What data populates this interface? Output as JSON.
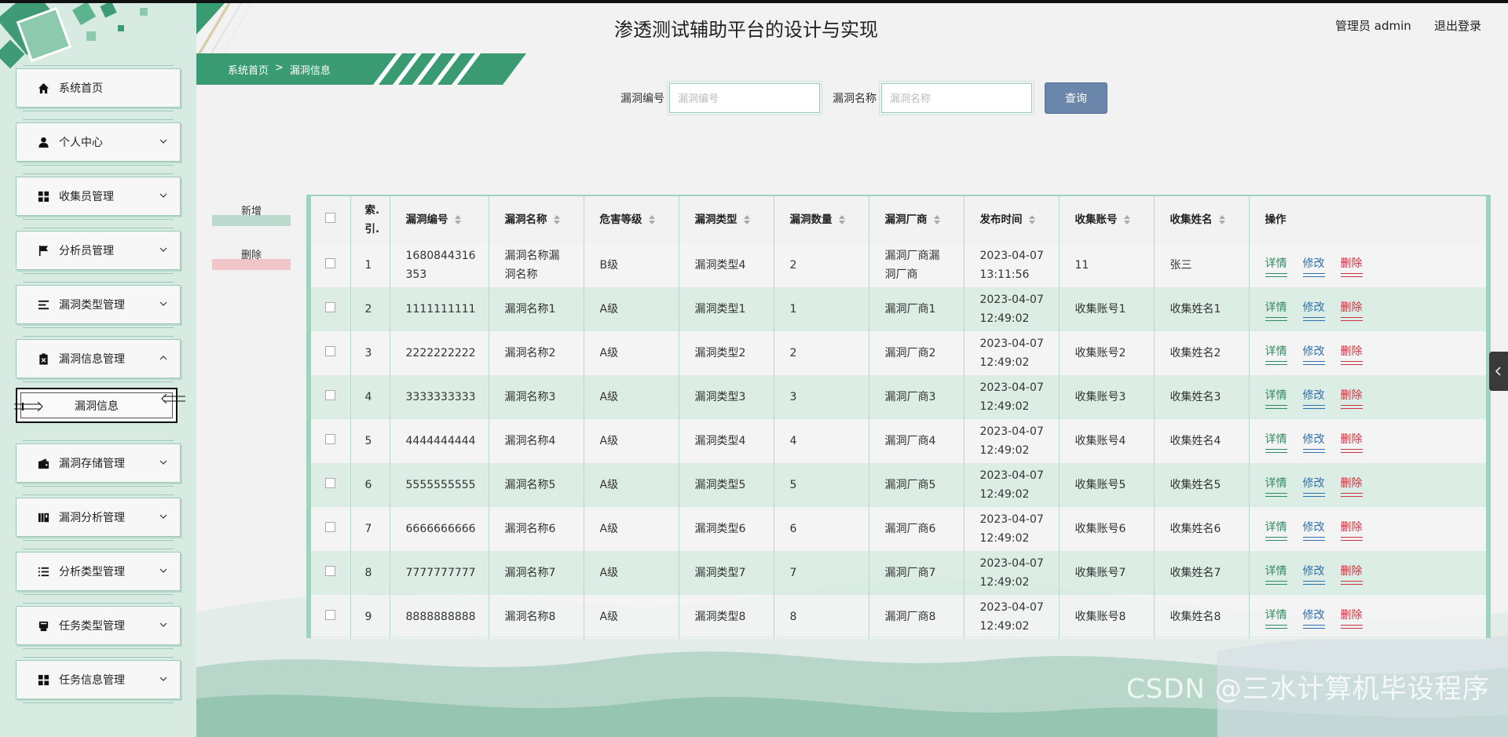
{
  "app": {
    "title": "渗透测试辅助平台的设计与实现",
    "user_label": "管理员 admin",
    "logout_label": "退出登录"
  },
  "breadcrumb": {
    "home": "系统首页",
    "separator": ">",
    "current": "漏洞信息"
  },
  "search": {
    "field1_label": "漏洞编号",
    "field1_placeholder": "漏洞编号",
    "field2_label": "漏洞名称",
    "field2_placeholder": "漏洞名称",
    "button_label": "查询"
  },
  "actions": {
    "add_label": "新增",
    "delete_label": "删除"
  },
  "sidebar": {
    "items": [
      {
        "label": "系统首页",
        "icon": "home-icon",
        "expandable": false
      },
      {
        "label": "个人中心",
        "icon": "user-icon",
        "expandable": true
      },
      {
        "label": "收集员管理",
        "icon": "grid-icon",
        "expandable": true
      },
      {
        "label": "分析员管理",
        "icon": "flag-icon",
        "expandable": true
      },
      {
        "label": "漏洞类型管理",
        "icon": "list-icon",
        "expandable": true
      },
      {
        "label": "漏洞信息管理",
        "icon": "clipboard-icon",
        "expandable": true,
        "expanded": true
      },
      {
        "label": "漏洞存储管理",
        "icon": "wallet-icon",
        "expandable": true
      },
      {
        "label": "漏洞分析管理",
        "icon": "book-icon",
        "expandable": true
      },
      {
        "label": "分析类型管理",
        "icon": "list-icon",
        "expandable": true
      },
      {
        "label": "任务类型管理",
        "icon": "printer-icon",
        "expandable": true
      },
      {
        "label": "任务信息管理",
        "icon": "grid-icon",
        "expandable": true
      }
    ],
    "active_sub_item": "漏洞信息"
  },
  "table": {
    "headers": [
      "索引",
      "漏洞编号",
      "漏洞名称",
      "危害等级",
      "漏洞类型",
      "漏洞数量",
      "漏洞厂商",
      "发布时间",
      "收集账号",
      "收集姓名",
      "操作"
    ],
    "index_header_line1": "索.",
    "index_header_line2": "引.",
    "rows": [
      {
        "idx": "1",
        "code_line1": "1680844316",
        "code_line2": "353",
        "name_line1": "漏洞名称漏",
        "name_line2": "洞名称",
        "level": "B级",
        "type": "漏洞类型4",
        "count": "2",
        "vendor_line1": "漏洞厂商漏",
        "vendor_line2": "洞厂商",
        "date": "2023-04-07",
        "time": "13:11:56",
        "account": "11",
        "collector": "张三"
      },
      {
        "idx": "2",
        "code_line1": "1111111111",
        "code_line2": "",
        "name_line1": "漏洞名称1",
        "name_line2": "",
        "level": "A级",
        "type": "漏洞类型1",
        "count": "1",
        "vendor_line1": "漏洞厂商1",
        "vendor_line2": "",
        "date": "2023-04-07",
        "time": "12:49:02",
        "account": "收集账号1",
        "collector": "收集姓名1"
      },
      {
        "idx": "3",
        "code_line1": "2222222222",
        "code_line2": "",
        "name_line1": "漏洞名称2",
        "name_line2": "",
        "level": "A级",
        "type": "漏洞类型2",
        "count": "2",
        "vendor_line1": "漏洞厂商2",
        "vendor_line2": "",
        "date": "2023-04-07",
        "time": "12:49:02",
        "account": "收集账号2",
        "collector": "收集姓名2"
      },
      {
        "idx": "4",
        "code_line1": "3333333333",
        "code_line2": "",
        "name_line1": "漏洞名称3",
        "name_line2": "",
        "level": "A级",
        "type": "漏洞类型3",
        "count": "3",
        "vendor_line1": "漏洞厂商3",
        "vendor_line2": "",
        "date": "2023-04-07",
        "time": "12:49:02",
        "account": "收集账号3",
        "collector": "收集姓名3"
      },
      {
        "idx": "5",
        "code_line1": "4444444444",
        "code_line2": "",
        "name_line1": "漏洞名称4",
        "name_line2": "",
        "level": "A级",
        "type": "漏洞类型4",
        "count": "4",
        "vendor_line1": "漏洞厂商4",
        "vendor_line2": "",
        "date": "2023-04-07",
        "time": "12:49:02",
        "account": "收集账号4",
        "collector": "收集姓名4"
      },
      {
        "idx": "6",
        "code_line1": "5555555555",
        "code_line2": "",
        "name_line1": "漏洞名称5",
        "name_line2": "",
        "level": "A级",
        "type": "漏洞类型5",
        "count": "5",
        "vendor_line1": "漏洞厂商5",
        "vendor_line2": "",
        "date": "2023-04-07",
        "time": "12:49:02",
        "account": "收集账号5",
        "collector": "收集姓名5"
      },
      {
        "idx": "7",
        "code_line1": "6666666666",
        "code_line2": "",
        "name_line1": "漏洞名称6",
        "name_line2": "",
        "level": "A级",
        "type": "漏洞类型6",
        "count": "6",
        "vendor_line1": "漏洞厂商6",
        "vendor_line2": "",
        "date": "2023-04-07",
        "time": "12:49:02",
        "account": "收集账号6",
        "collector": "收集姓名6"
      },
      {
        "idx": "8",
        "code_line1": "7777777777",
        "code_line2": "",
        "name_line1": "漏洞名称7",
        "name_line2": "",
        "level": "A级",
        "type": "漏洞类型7",
        "count": "7",
        "vendor_line1": "漏洞厂商7",
        "vendor_line2": "",
        "date": "2023-04-07",
        "time": "12:49:02",
        "account": "收集账号7",
        "collector": "收集姓名7"
      },
      {
        "idx": "9",
        "code_line1": "8888888888",
        "code_line2": "",
        "name_line1": "漏洞名称8",
        "name_line2": "",
        "level": "A级",
        "type": "漏洞类型8",
        "count": "8",
        "vendor_line1": "漏洞厂商8",
        "vendor_line2": "",
        "date": "2023-04-07",
        "time": "12:49:02",
        "account": "收集账号8",
        "collector": "收集姓名8"
      }
    ],
    "ops": {
      "detail": "详情",
      "edit": "修改",
      "delete": "删除"
    }
  },
  "watermark": "CSDN @三水计算机毕设程序",
  "colors": {
    "sidebar_bg": "#d7ebe2",
    "accent_green": "#3a9a72",
    "query_button": "#6a86ab",
    "detail": "#2d8a5f",
    "edit": "#2f6fb0",
    "delete": "#c9343f"
  }
}
